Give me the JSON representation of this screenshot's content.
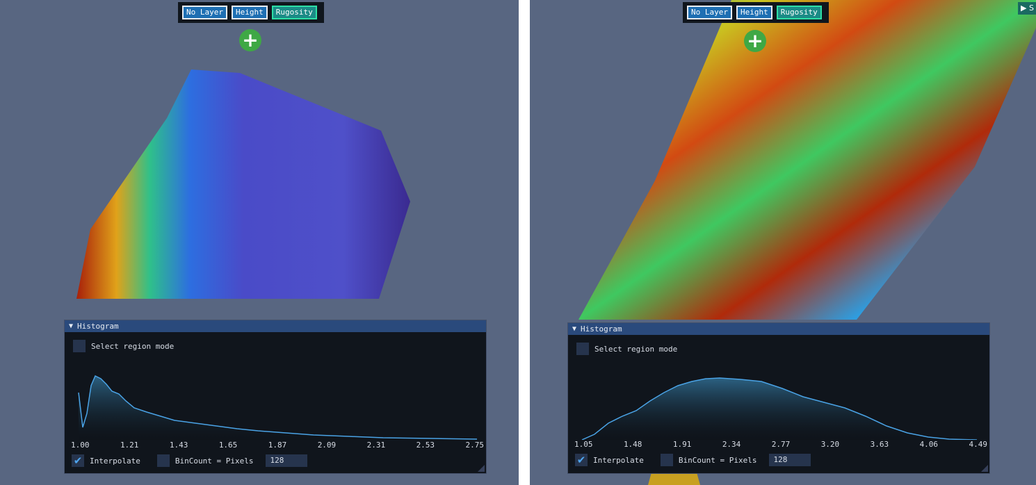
{
  "left": {
    "layer_buttons": [
      "No Layer",
      "Height",
      "Rugosity"
    ],
    "active_layer": "Rugosity",
    "add_icon": "plus-icon",
    "histogram": {
      "title": "Histogram",
      "select_region_label": "Select region mode",
      "select_region_checked": false,
      "x_ticks": [
        "1.00",
        "1.21",
        "1.43",
        "1.65",
        "1.87",
        "2.09",
        "2.31",
        "2.53",
        "2.75"
      ],
      "interpolate_label": "Interpolate",
      "interpolate_checked": true,
      "bincount_label": "BinCount = Pixels",
      "bincount_checked": false,
      "bin_value": "128"
    }
  },
  "right": {
    "layer_buttons": [
      "No Layer",
      "Height",
      "Rugosity"
    ],
    "active_layer": "Rugosity",
    "add_icon": "plus-icon",
    "settings_tab_label": "▶ S",
    "histogram": {
      "title": "Histogram",
      "select_region_label": "Select region mode",
      "select_region_checked": false,
      "x_ticks": [
        "1.05",
        "1.48",
        "1.91",
        "2.34",
        "2.77",
        "3.20",
        "3.63",
        "4.06",
        "4.49"
      ],
      "interpolate_label": "Interpolate",
      "interpolate_checked": true,
      "bincount_label": "BinCount = Pixels",
      "bincount_checked": false,
      "bin_value": "128"
    }
  },
  "colors": {
    "background": "#586681",
    "window_bg": "#0b0f14",
    "title_bar": "#2a4a7c",
    "plot_line": "#4aa3e6",
    "active_button_border": "#2ee0a6",
    "button_bg": "#1e6fb3",
    "add_button": "#3fa845"
  }
}
